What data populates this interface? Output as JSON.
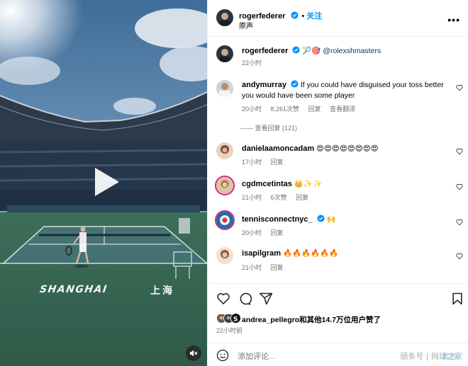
{
  "post": {
    "author": "rogerfederer",
    "follow_label": "关注",
    "audio_label": "原声",
    "more_icon": "more-horizontal-icon",
    "caption_author": "rogerfederer",
    "caption_emojis": "🎾🎯",
    "caption_mention": "@rolexshmasters",
    "caption_time": "22小时"
  },
  "video": {
    "court_text": "SHANGHAI",
    "court_text_cn": "上海",
    "play_icon": "play-icon",
    "mute_icon": "speaker-muted-icon"
  },
  "comments": [
    {
      "username": "andymurray",
      "verified": true,
      "text": "If you could have disguised your toss better you would have been some player",
      "time": "20小时",
      "likes": "8,261次赞",
      "reply": "回复",
      "translate": "查看翻译",
      "view_replies": "—— 查看回复 (121)"
    },
    {
      "username": "danielaamoncadam",
      "verified": false,
      "text": "😍😍😍😍😍😍😍😍",
      "time": "17小时",
      "likes": "",
      "reply": "回复"
    },
    {
      "username": "cgdmcetintas",
      "verified": false,
      "text": "👑✨✨",
      "time": "21小时",
      "likes": "6次赞",
      "reply": "回复"
    },
    {
      "username": "tennisconnectnyc_",
      "verified": true,
      "text": "🙌",
      "time": "20小时",
      "likes": "",
      "reply": "回复"
    },
    {
      "username": "isapilgram",
      "verified": false,
      "text": "🔥🔥🔥🔥🔥🔥",
      "time": "21小时",
      "likes": "",
      "reply": "回复"
    }
  ],
  "footer": {
    "likes_text": "andrea_pellegro和其他14.7万位用户赞了",
    "post_time": "22小时前",
    "comment_placeholder": "添加评论...",
    "post_button": "发布",
    "watermark": "頭条号 | 网球之家"
  },
  "colors": {
    "accent": "#0095f6",
    "secondary_text": "#737373",
    "divider": "#efefef",
    "court_green": "#3c6b55",
    "sky": "#5b86ad"
  }
}
